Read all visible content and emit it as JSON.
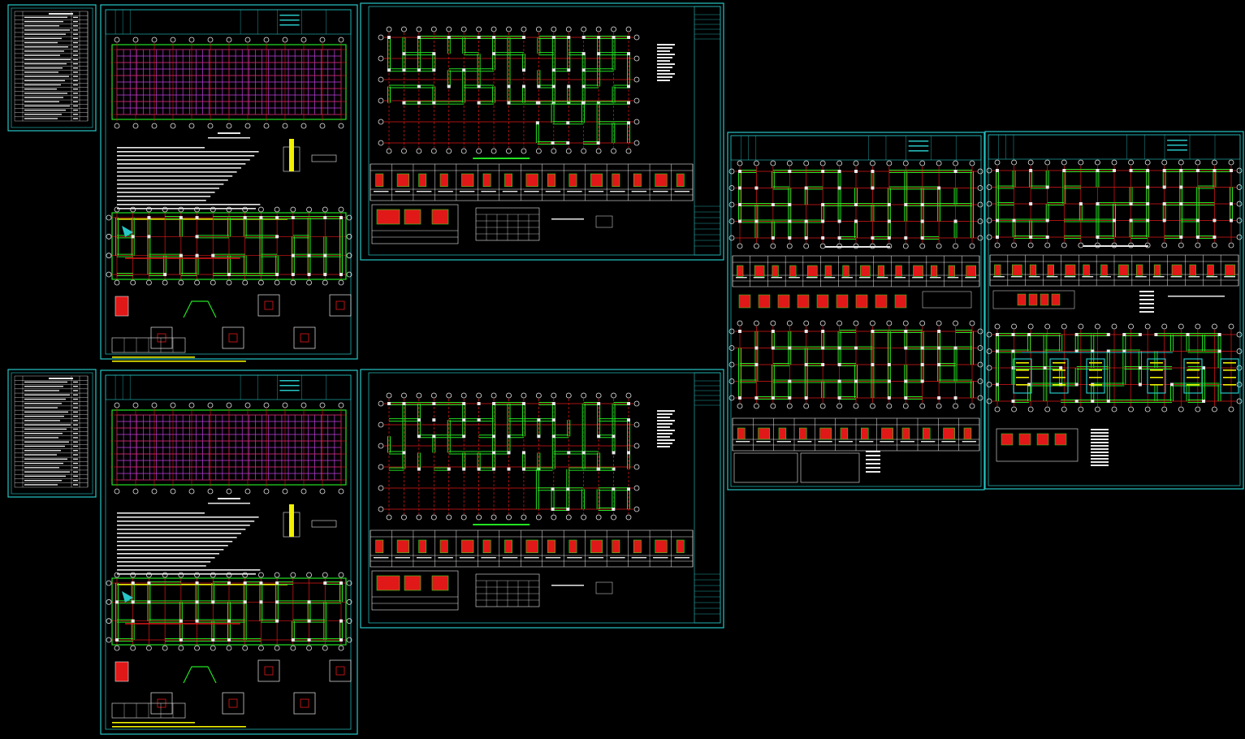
{
  "drawing": {
    "background": "#000000",
    "colors": {
      "frame": "#27c6c6",
      "grid_red": "#e01818",
      "wall_green": "#22e222",
      "white": "#e8e8e8",
      "magenta": "#c040e0",
      "yellow": "#f0f000",
      "cyan_text": "#27c6c6"
    },
    "sheet_groups": [
      {
        "name": "left-column",
        "sheets": [
          "index-table-1",
          "foundation-plan-1",
          "index-table-2",
          "foundation-plan-2"
        ]
      },
      {
        "name": "middle-column",
        "sheets": [
          "structural-plan-1",
          "structural-plan-2"
        ]
      },
      {
        "name": "right-group",
        "sheets": [
          "structural-plan-3",
          "structural-plan-4"
        ]
      }
    ]
  }
}
